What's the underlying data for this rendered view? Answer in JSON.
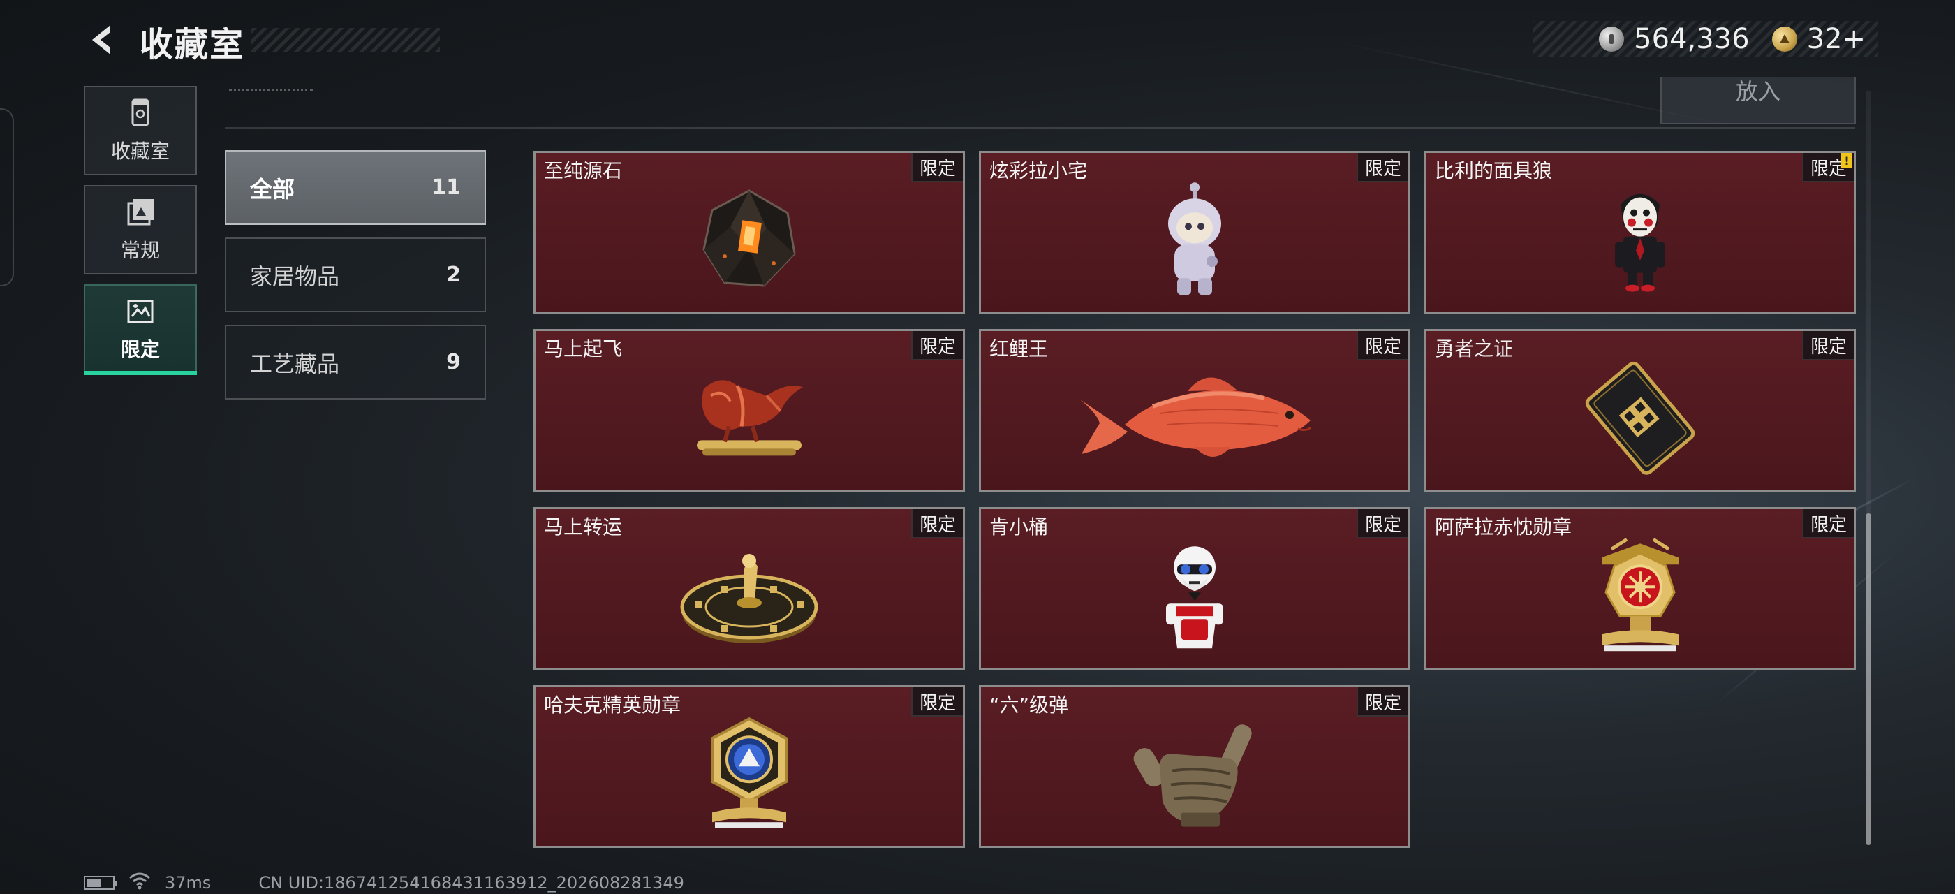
{
  "header": {
    "title": "收藏室",
    "currency": [
      {
        "icon": "silver-coin-icon",
        "value": "564,336"
      },
      {
        "icon": "gold-coin-icon",
        "value": "32+"
      }
    ]
  },
  "side_nav": [
    {
      "label": "收藏室",
      "icon": "collection-room-icon",
      "active": false
    },
    {
      "label": "常规",
      "icon": "regular-icon",
      "active": false
    },
    {
      "label": "限定",
      "icon": "limited-icon",
      "active": true
    }
  ],
  "top_bar": {
    "put_label": "放入"
  },
  "categories": [
    {
      "name": "全部",
      "count": "11",
      "active": true
    },
    {
      "name": "家居物品",
      "count": "2",
      "active": false
    },
    {
      "name": "工艺藏品",
      "count": "9",
      "active": false
    }
  ],
  "items": [
    {
      "name": "至纯源石",
      "tag": "限定",
      "art": "crystal"
    },
    {
      "name": "炫彩拉小宅",
      "tag": "限定",
      "art": "figure"
    },
    {
      "name": "比利的面具狼",
      "tag": "限定",
      "art": "puppet",
      "warning": "!"
    },
    {
      "name": "马上起飞",
      "tag": "限定",
      "art": "horse"
    },
    {
      "name": "红鲤王",
      "tag": "限定",
      "art": "fish"
    },
    {
      "name": "勇者之证",
      "tag": "限定",
      "art": "card"
    },
    {
      "name": "马上转运",
      "tag": "限定",
      "art": "disc"
    },
    {
      "name": "肯小桶",
      "tag": "限定",
      "art": "kfc"
    },
    {
      "name": "阿萨拉赤忱勋章",
      "tag": "限定",
      "art": "medal-red"
    },
    {
      "name": "哈夫克精英勋章",
      "tag": "限定",
      "art": "medal-blue"
    },
    {
      "name": "“六”级弹",
      "tag": "限定",
      "art": "hand"
    }
  ],
  "status": {
    "battery_level": 0.55,
    "ping": "37ms",
    "uid": "CN UID:18674125416843116391​2_202608281349"
  },
  "colors": {
    "card_bg": "#511a20",
    "accent_green": "#29d3a0",
    "warning": "#f0c419"
  }
}
